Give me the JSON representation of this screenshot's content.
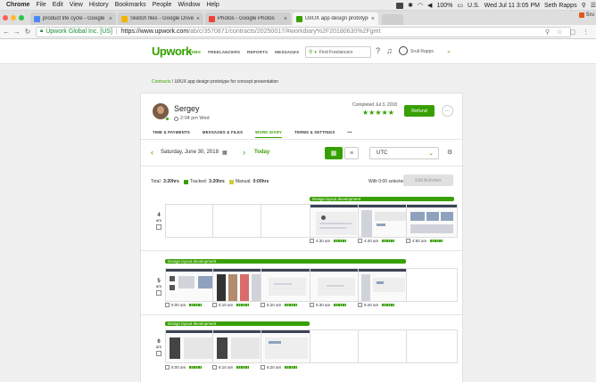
{
  "menubar": {
    "app": "Chrome",
    "items": [
      "File",
      "Edit",
      "View",
      "History",
      "Bookmarks",
      "People",
      "Window",
      "Help"
    ],
    "battery": "100%",
    "input_source": "U.S.",
    "clock": "Wed Jul 11  3:05 PM",
    "user": "Seth Rapps"
  },
  "tabs": [
    {
      "title": "product life cycle - Google Se",
      "color": "#4a8af4"
    },
    {
      "title": "Sketch files - Google Drive",
      "color": "#f4b400"
    },
    {
      "title": "Photos - Google Photos",
      "color": "#ea4335"
    },
    {
      "title": "UI/UX app design prototype fo",
      "color": "#37a000"
    }
  ],
  "tab_corner": "Sru",
  "address": {
    "site_name": "Upwork Global Inc. [US]",
    "separator": "|",
    "host": "https://www.upwork.com",
    "path": "/ab/c/3570871/contracts/20250017/#workdiary%2F20180630%2Fgmt"
  },
  "upwork": {
    "logo": "Upwork",
    "nav": [
      "JOBS",
      "FREELANCERS",
      "REPORTS",
      "MESSAGES"
    ],
    "search_placeholder": "Find Freelancers",
    "user_name": "Sruli Rapps",
    "breadcrumb_link": "Contracts",
    "breadcrumb_sep": "/",
    "breadcrumb_current": "UI/UX app design prototype for concept presentation"
  },
  "profile": {
    "name": "Sergey",
    "local_time": "2:04 pm Wed",
    "completed": "Completed Jul 3, 2018",
    "stars": "★★★★★",
    "rating": 5,
    "refund_label": "Refund",
    "more_label": "···"
  },
  "contract_tabs": [
    "TIME & PAYMENTS",
    "MESSAGES & FILES",
    "WORK DIARY",
    "TERMS & SETTINGS",
    "•••"
  ],
  "active_tab": "WORK DIARY",
  "diary": {
    "date": "Saturday, June 30, 2018",
    "today_label": "Today",
    "timezone": "UTC",
    "total_label": "Total:",
    "total_value": "3:20hrs",
    "tracked_label": "Tracked:",
    "tracked_value": "3:20hrs",
    "manual_label": "Manual:",
    "manual_value": "0:00hrs",
    "selected_text": "With 0:00 selected:",
    "edit_label": "Edit Activities",
    "colors": {
      "tracked": "#37a000",
      "manual": "#c9d23a"
    }
  },
  "rows": [
    {
      "hour": "4",
      "ampm": "am",
      "memo": "Design layout development",
      "slots": [
        {
          "time": ""
        },
        {
          "time": ""
        },
        {
          "time": ""
        },
        {
          "time": "4:30 am"
        },
        {
          "time": "4:40 am"
        },
        {
          "time": "4:50 am"
        }
      ]
    },
    {
      "hour": "5",
      "ampm": "am",
      "memo": "Design layout development",
      "slots": [
        {
          "time": "5:00 am"
        },
        {
          "time": "5:10 am"
        },
        {
          "time": "5:20 am"
        },
        {
          "time": "5:30 am"
        },
        {
          "time": "5:40 am"
        },
        {
          "time": ""
        }
      ]
    },
    {
      "hour": "6",
      "ampm": "am",
      "memo": "Design layout development",
      "slots": [
        {
          "time": "6:00 am"
        },
        {
          "time": "6:10 am"
        },
        {
          "time": "6:20 am"
        },
        {
          "time": ""
        },
        {
          "time": ""
        },
        {
          "time": ""
        }
      ]
    }
  ]
}
